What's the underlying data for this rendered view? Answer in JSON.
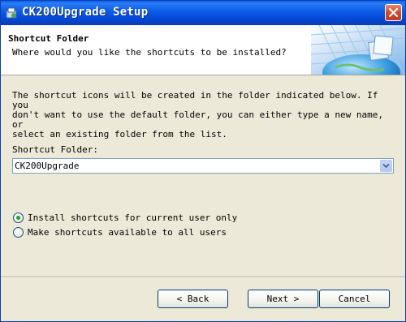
{
  "window": {
    "title": "CK200Upgrade Setup"
  },
  "header": {
    "title": "Shortcut Folder",
    "subtitle": "Where would you like the shortcuts to be installed?"
  },
  "body": {
    "description": "The shortcut icons will be created in the folder indicated below. If you\ndon't want to use the default folder, you can either type a new name, or\nselect an existing folder from the list.",
    "folder_label": "Shortcut Folder:",
    "folder_value": "CK200Upgrade",
    "radio_options": [
      {
        "label": "Install shortcuts for current user only",
        "selected": true
      },
      {
        "label": "Make shortcuts available to all users",
        "selected": false
      }
    ]
  },
  "buttons": {
    "back": "< Back",
    "next": "Next >",
    "cancel": "Cancel"
  },
  "icons": {
    "app": "installer-icon",
    "close": "close-icon",
    "dropdown": "chevron-down-icon"
  },
  "colors": {
    "titlebar": "#0a5ae6",
    "dialog_bg": "#ece9d8",
    "close": "#d1452a",
    "radio_dot": "#21a121"
  }
}
